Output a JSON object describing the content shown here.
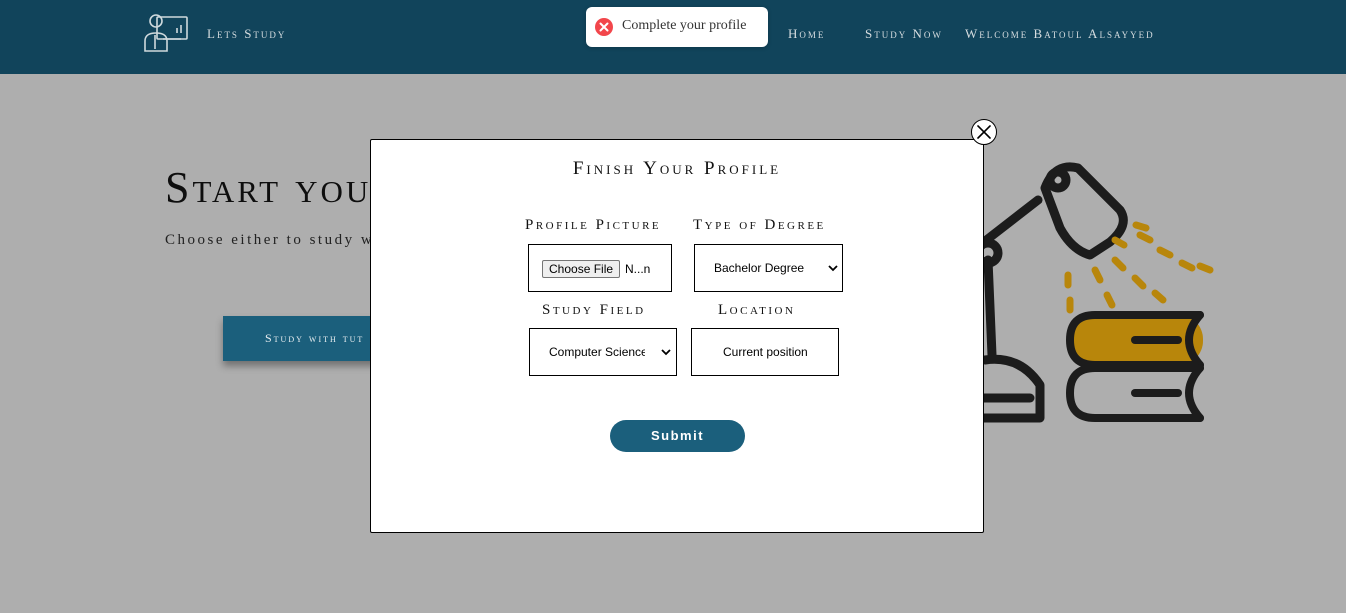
{
  "header": {
    "brand": "Lets Study",
    "nav": [
      "Home",
      "Study Now",
      "Welcome Batoul Alsayyed"
    ]
  },
  "toast": {
    "message": "Complete your profile",
    "icon": "error-circle-icon",
    "color": "#f2464b"
  },
  "hero": {
    "title": "Start your",
    "subtitle": "Choose either to study wi",
    "button": "Study with tut"
  },
  "modal": {
    "title": "Finish Your Profile",
    "profile_picture": {
      "label": "Profile Picture",
      "button": "Choose File",
      "file_name": "N...n"
    },
    "degree": {
      "label": "Type of Degree",
      "value": "Bachelor Degree"
    },
    "study_field": {
      "label": "Study Field",
      "value": "Computer Science"
    },
    "location": {
      "label": "Location",
      "value": "Current position"
    },
    "submit": "Submit"
  },
  "colors": {
    "header_bg": "#11445b",
    "accent": "#1b5f7c",
    "book_yellow": "#b8860b"
  }
}
